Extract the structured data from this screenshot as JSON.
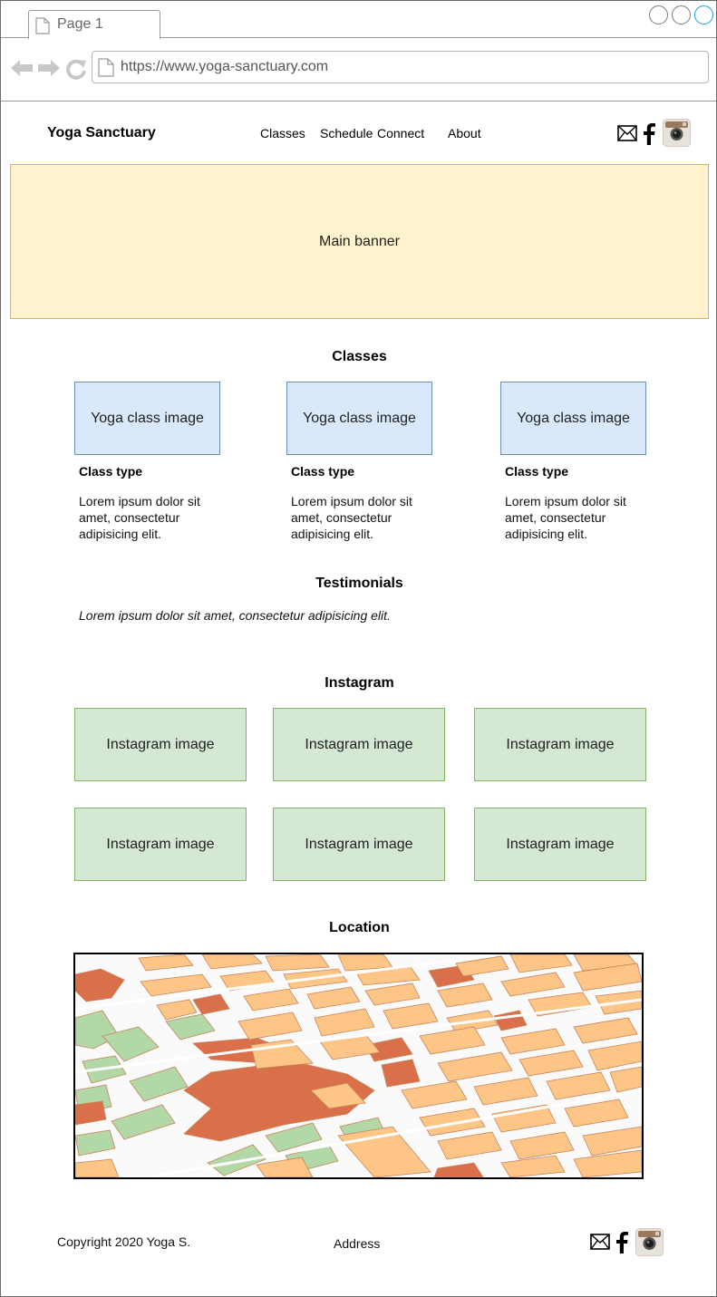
{
  "browser": {
    "tab_label": "Page 1",
    "url": "https://www.yoga-sanctuary.com"
  },
  "header": {
    "brand": "Yoga Sanctuary",
    "nav": [
      "Classes",
      "Schedule",
      "Connect",
      "About"
    ]
  },
  "banner": {
    "label": "Main banner"
  },
  "classes": {
    "title": "Classes",
    "items": [
      {
        "image_label": "Yoga class image",
        "type": "Class type",
        "description": "Lorem ipsum dolor sit amet, consectetur adipisicing elit."
      },
      {
        "image_label": "Yoga class image",
        "type": "Class type",
        "description": "Lorem ipsum dolor sit amet, consectetur adipisicing elit."
      },
      {
        "image_label": "Yoga class image",
        "type": "Class type",
        "description": "Lorem ipsum dolor sit amet, consectetur adipisicing elit."
      }
    ]
  },
  "testimonials": {
    "title": "Testimonials",
    "quote": "Lorem ipsum dolor sit amet, consectetur adipisicing elit."
  },
  "instagram": {
    "title": "Instagram",
    "images": [
      "Instagram image",
      "Instagram image",
      "Instagram image",
      "Instagram image",
      "Instagram image",
      "Instagram image"
    ]
  },
  "location": {
    "title": "Location"
  },
  "footer": {
    "copyright": "Copyright 2020 Yoga S.",
    "address": "Address"
  },
  "icons": {
    "mail": "mail-icon",
    "facebook": "facebook-icon",
    "instagram": "instagram-icon"
  },
  "colors": {
    "banner_fill": "#fff2cc",
    "class_fill": "#dae8fc",
    "insta_fill": "#d5e8d4",
    "map_block": "#fdc586",
    "map_dark": "#d9704a",
    "map_park": "#b3d8a7"
  }
}
